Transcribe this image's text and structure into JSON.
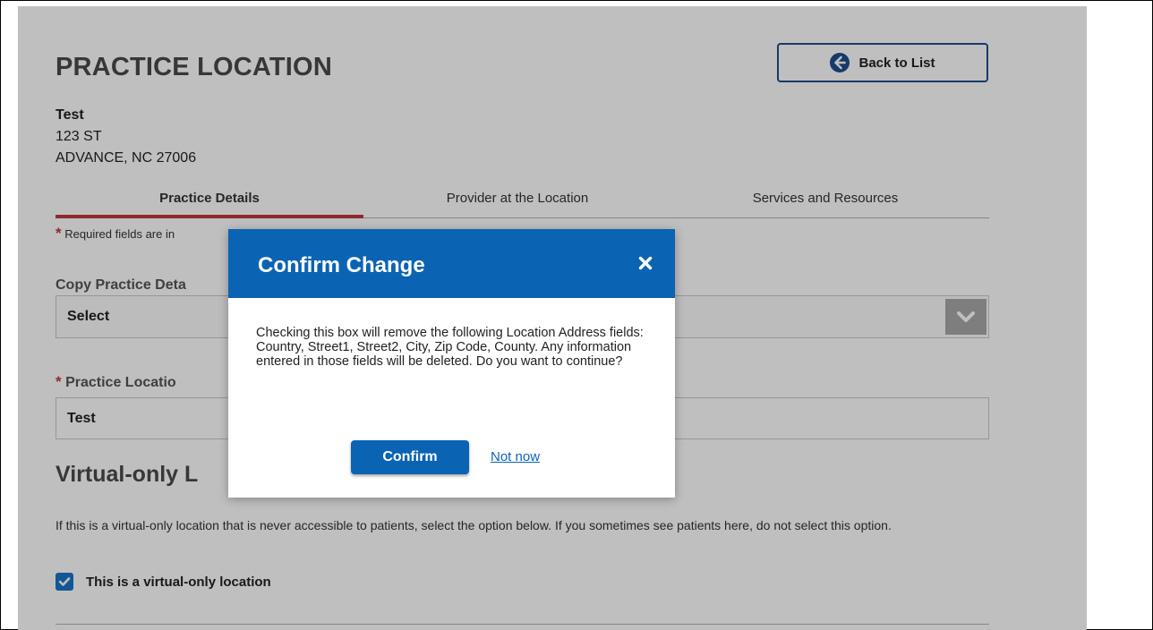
{
  "page": {
    "title": "PRACTICE LOCATION",
    "back_button": "Back to List"
  },
  "location": {
    "name": "Test",
    "street": "123 ST",
    "city_state_zip": "ADVANCE, NC 27006"
  },
  "tabs": [
    {
      "label": "Practice Details",
      "active": true
    },
    {
      "label": "Provider at the Location",
      "active": false
    },
    {
      "label": "Services and Resources",
      "active": false
    }
  ],
  "form": {
    "required_star": "*",
    "required_note": "Required fields are in",
    "copy_label": "Copy Practice Deta",
    "copy_select_value": "Select",
    "location_label": "Practice Locatio",
    "location_value": "Test",
    "virtual_section_title": "Virtual-only L",
    "virtual_desc": "If this is a virtual-only location that is never accessible to patients, select the option below. If you sometimes see patients here, do not select this option.",
    "virtual_checkbox_label": "This is a virtual-only location",
    "virtual_checked": true
  },
  "modal": {
    "title": "Confirm Change",
    "body": "Checking this box will remove the following Location Address fields: Country, Street1, Street2, City, Zip Code, County. Any information entered in those fields will be deleted. Do you want to continue?",
    "confirm_label": "Confirm",
    "notnow_label": "Not now"
  },
  "colors": {
    "primary": "#0b63b4",
    "accent_red": "#c0373f",
    "back_border": "#1f4e8c"
  },
  "icons": {
    "back": "arrow-left-circle-icon",
    "close": "close-x-icon",
    "chevron": "chevron-down-icon",
    "check": "check-icon"
  }
}
